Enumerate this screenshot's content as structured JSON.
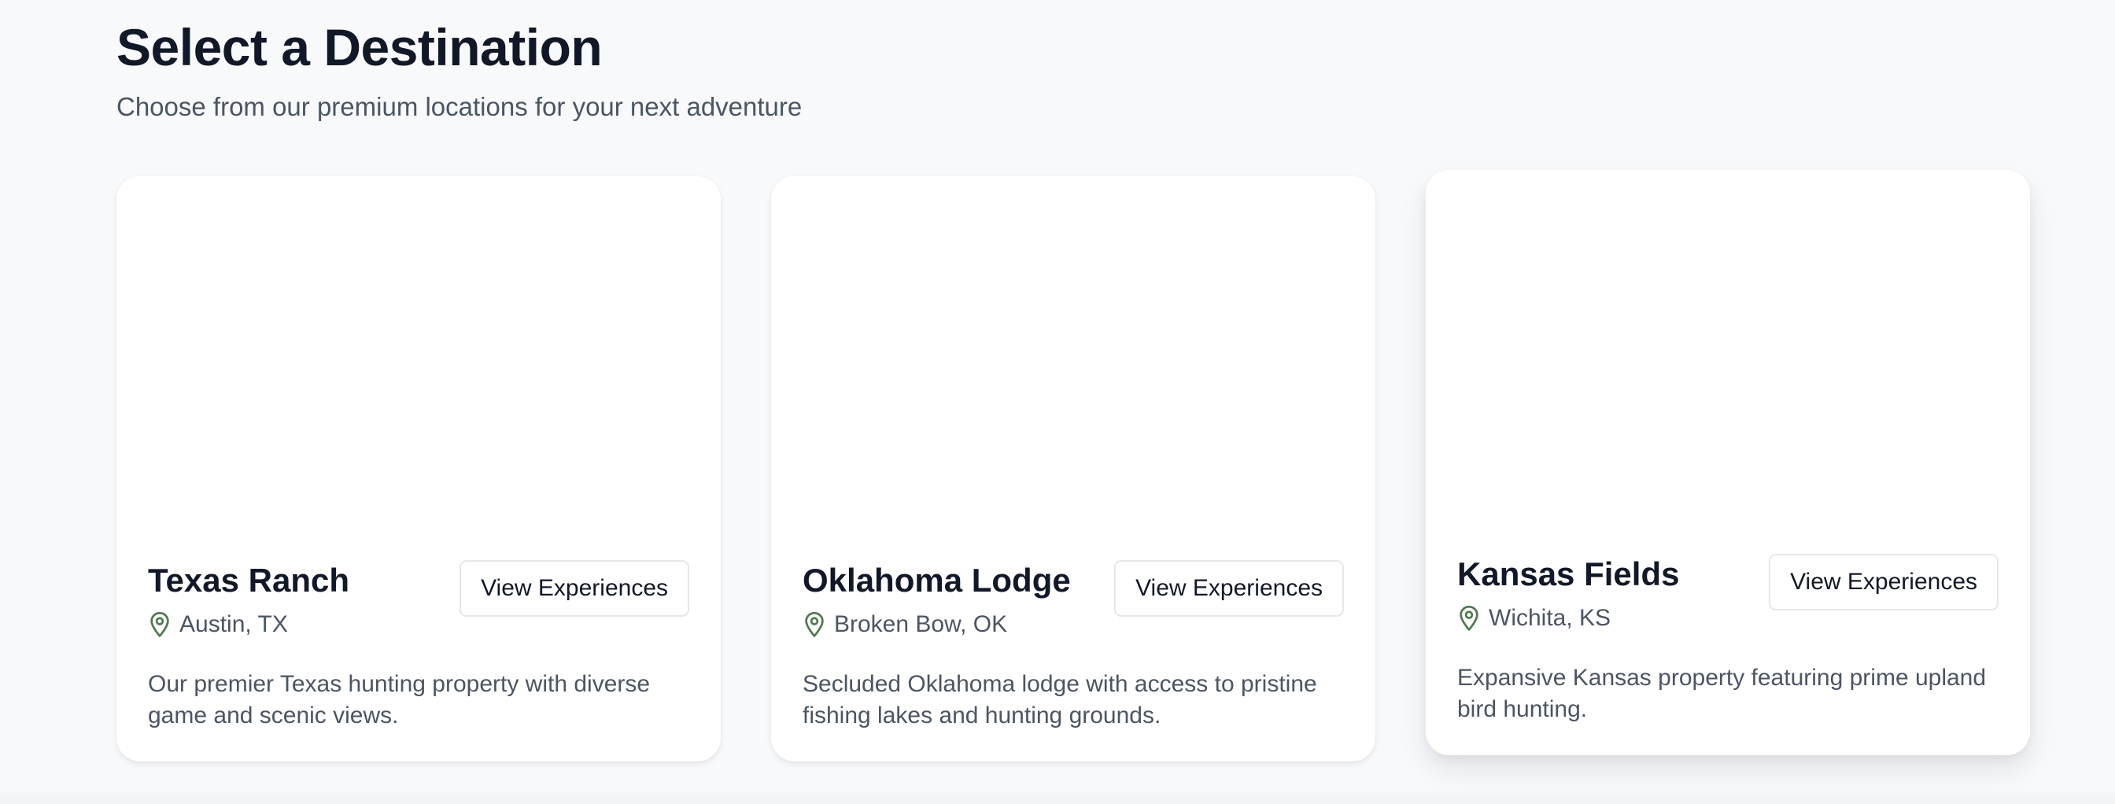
{
  "header": {
    "title": "Select a Destination",
    "subtitle": "Choose from our premium locations for your next adventure"
  },
  "destinations": [
    {
      "name": "Texas Ranch",
      "location": "Austin, TX",
      "description": "Our premier Texas hunting property with diverse game and scenic views.",
      "button_label": "View Experiences"
    },
    {
      "name": "Oklahoma Lodge",
      "location": "Broken Bow, OK",
      "description": "Secluded Oklahoma lodge with access to pristine fishing lakes and hunting grounds.",
      "button_label": "View Experiences"
    },
    {
      "name": "Kansas Fields",
      "location": "Wichita, KS",
      "description": "Expansive Kansas property featuring prime upland bird hunting.",
      "button_label": "View Experiences"
    }
  ],
  "icons": {
    "location": "map-pin-icon"
  },
  "colors": {
    "background": "#f8f9fb",
    "card": "#ffffff",
    "heading": "#111827",
    "muted_text": "#4b5563",
    "pin_icon": "#4f7a4f",
    "button_border": "#e5e7eb"
  }
}
